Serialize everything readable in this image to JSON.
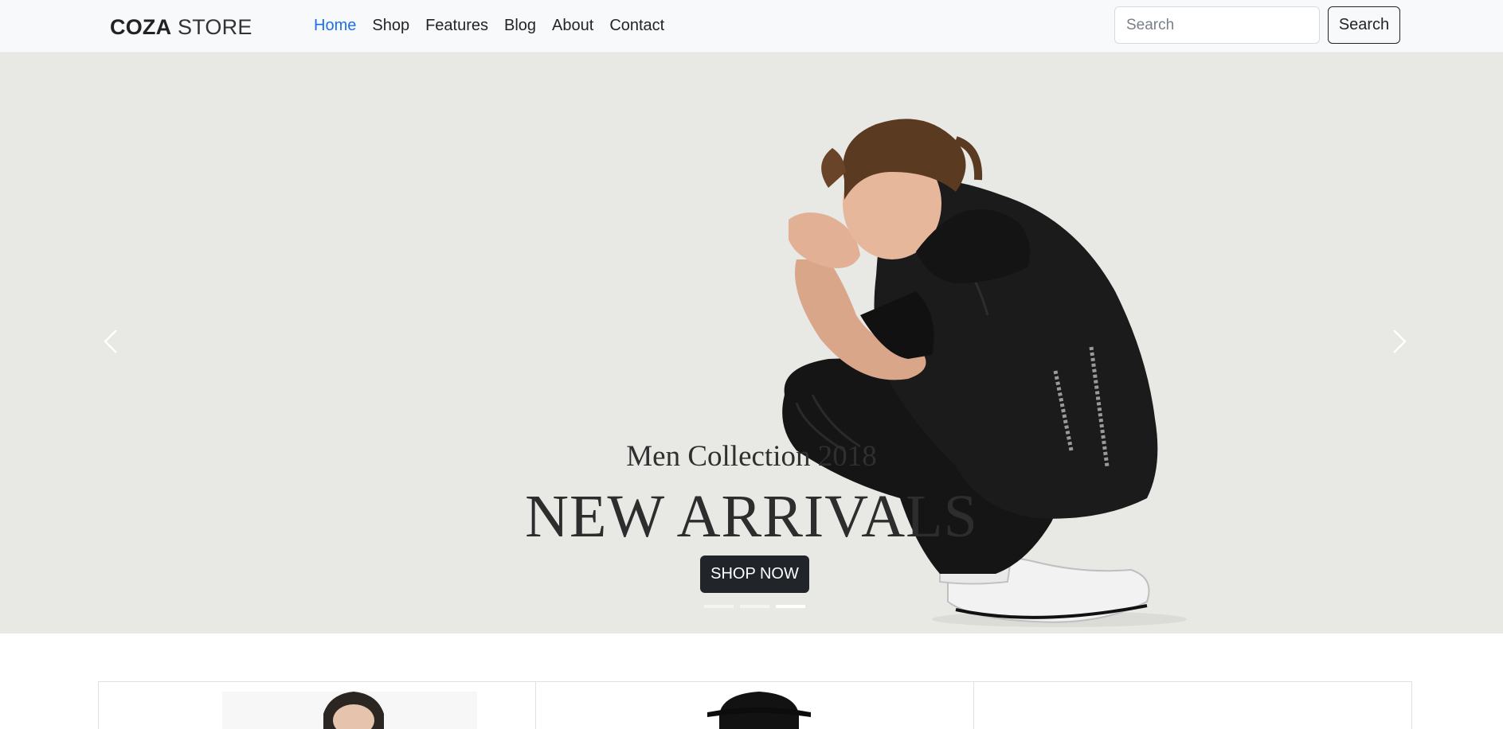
{
  "brand": {
    "bold": "COZA",
    "light": "STORE"
  },
  "nav": {
    "links": [
      {
        "label": "Home",
        "active": true
      },
      {
        "label": "Shop"
      },
      {
        "label": "Features"
      },
      {
        "label": "Blog"
      },
      {
        "label": "About"
      },
      {
        "label": "Contact"
      }
    ]
  },
  "search": {
    "placeholder": "Search",
    "button_label": "Search"
  },
  "hero": {
    "subtitle": "Men Collection 2018",
    "title": "NEW ARRIVALS",
    "cta_label": "SHOP NOW",
    "slides_count": 3,
    "active_slide": 3,
    "prev_icon": "chevron-left-icon",
    "next_icon": "chevron-right-icon"
  },
  "colors": {
    "accent": "#1f6feb",
    "dark": "#212529",
    "hero_bg": "#e8e8e4"
  }
}
